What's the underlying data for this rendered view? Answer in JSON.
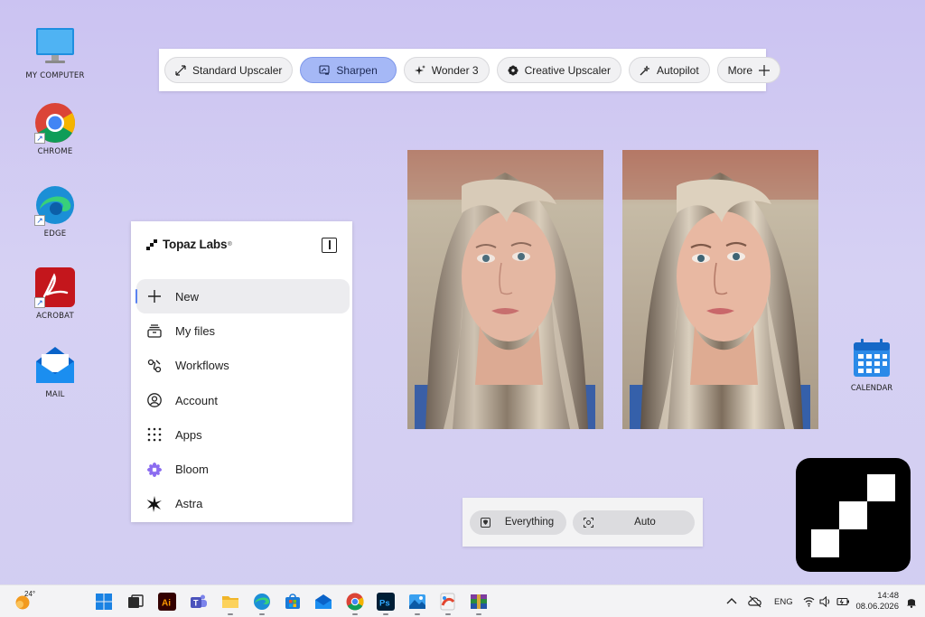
{
  "desktop": {
    "icons": [
      {
        "label": "MY COMPUTER",
        "icon": "monitor-icon"
      },
      {
        "label": "CHROME",
        "icon": "chrome-icon"
      },
      {
        "label": "EDGE",
        "icon": "edge-icon"
      },
      {
        "label": "ACROBAT",
        "icon": "acrobat-icon"
      },
      {
        "label": "MAIL",
        "icon": "mail-icon"
      }
    ],
    "calendar_label": "CALENDAR"
  },
  "toolbar": {
    "buttons": [
      {
        "label": "Standard Upscaler",
        "icon": "expand-arrows-icon"
      },
      {
        "label": "Sharpen",
        "icon": "sharpen-icon",
        "active": true
      },
      {
        "label": "Wonder 3",
        "icon": "sparkle-icon"
      },
      {
        "label": "Creative Upscaler",
        "icon": "flower-icon"
      },
      {
        "label": "Autopilot",
        "icon": "magic-wand-icon"
      },
      {
        "label": "More",
        "icon": "plus-icon"
      }
    ],
    "active_color": "#a5b8f6"
  },
  "sidebar": {
    "brand": "Topaz Labs",
    "brand_mark": "®",
    "items": [
      {
        "label": "New",
        "icon": "plus-icon",
        "active": true
      },
      {
        "label": "My files",
        "icon": "files-icon"
      },
      {
        "label": "Workflows",
        "icon": "workflow-icon"
      },
      {
        "label": "Account",
        "icon": "account-icon"
      },
      {
        "label": "Apps",
        "icon": "apps-grid-icon"
      },
      {
        "label": "Bloom",
        "icon": "bloom-icon"
      },
      {
        "label": "Astra",
        "icon": "astra-icon"
      }
    ],
    "accent": "#5a82f0"
  },
  "controls": {
    "everything_label": "Everything",
    "auto_label": "Auto"
  },
  "taskbar": {
    "weather": "24°",
    "language": "ENG",
    "time": "14:48",
    "date": "08.06.2026"
  }
}
